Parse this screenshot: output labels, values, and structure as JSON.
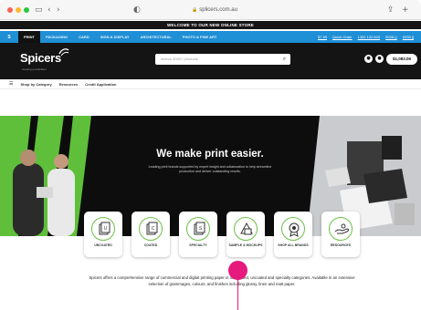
{
  "browser": {
    "url": "splicers.com.au",
    "back_icon": "chevron-left-icon",
    "forward_icon": "chevron-right-icon"
  },
  "promo_banner": "WELCOME TO OUR NEW ONLINE STORE",
  "nav": {
    "tabs": [
      "PRINT",
      "PACKAGING",
      "CARD",
      "SIGN & DISPLAY",
      "ARCHITECTURAL",
      "PHOTO & FINE ART"
    ],
    "active_tab": "PRINT",
    "right_links": [
      "$7.99",
      "Quick Order",
      "1300 132 843",
      "0038 ()",
      "0038 []"
    ]
  },
  "header": {
    "brand": "Spicers",
    "brand_tagline": "creating possibilities",
    "search_placeholder": "search 4000+ products",
    "cart_total": "$1,083.06"
  },
  "subnav": {
    "items": [
      "Shop by Category",
      "Resources",
      "Credit Application"
    ]
  },
  "hero": {
    "title": "We make print easier.",
    "subtitle": "Leading print brands supported by expert insight and collaboration to help streamline production and deliver outstanding results."
  },
  "categories": [
    {
      "label": "UNCOATED",
      "letter": "U"
    },
    {
      "label": "COATED",
      "letter": "C"
    },
    {
      "label": "SPECIALTY",
      "letter": "S"
    },
    {
      "label": "SAMPLE & MOCKUPS",
      "letter": ""
    },
    {
      "label": "SHOP ALL BRANDS",
      "letter": ""
    },
    {
      "label": "RESOURCES",
      "letter": ""
    }
  ],
  "description": "Spicers offers a comprehensive range of commercial and digital printing paper in our coated, uncoated and specialty categories. Available in an extensive selection of grammages, colours, and finishes including glossy, linen and matt paper.",
  "colors": {
    "accent_green": "#6cc04a",
    "nav_blue": "#1f8fd6",
    "cursor_pink": "#e6197d"
  }
}
